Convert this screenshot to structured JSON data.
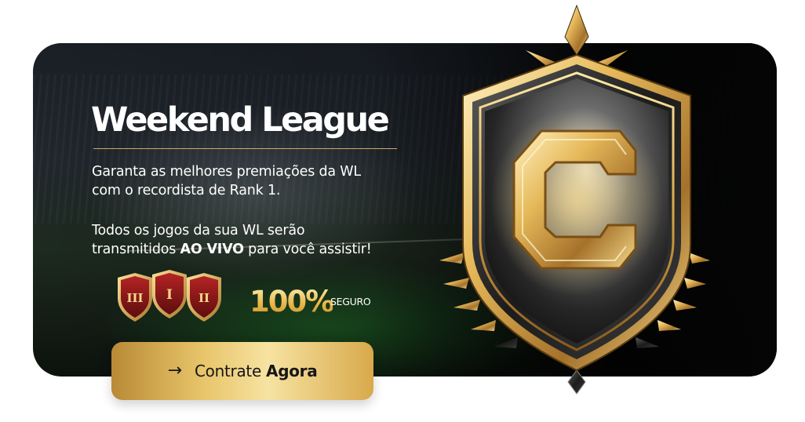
{
  "banner": {
    "title": "Weekend League",
    "description_line1": "Garanta as melhores premiações da WL",
    "description_line2": "com o recordista de Rank 1.",
    "live_line1": "Todos os jogos da sua WL serão",
    "live_prefix": "transmitidos ",
    "live_emphasis": "AO VIVO",
    "live_suffix": " para você assistir!",
    "badges": [
      {
        "numeral": "III"
      },
      {
        "numeral": "I"
      },
      {
        "numeral": "II"
      }
    ],
    "security_percent": "100%",
    "security_label": "SEGURO"
  },
  "cta": {
    "arrow_icon": "arrow-right-icon",
    "label_regular": "Contrate",
    "label_bold": "Agora"
  },
  "emblem": {
    "letter": "C",
    "icon": "gold-shield-emblem-icon"
  },
  "colors": {
    "gold": "#e8c56a",
    "gold_dark": "#b98a36",
    "background_dark": "#0a0d0f",
    "text": "#ffffff",
    "badge_red": "#8e1a1a"
  }
}
